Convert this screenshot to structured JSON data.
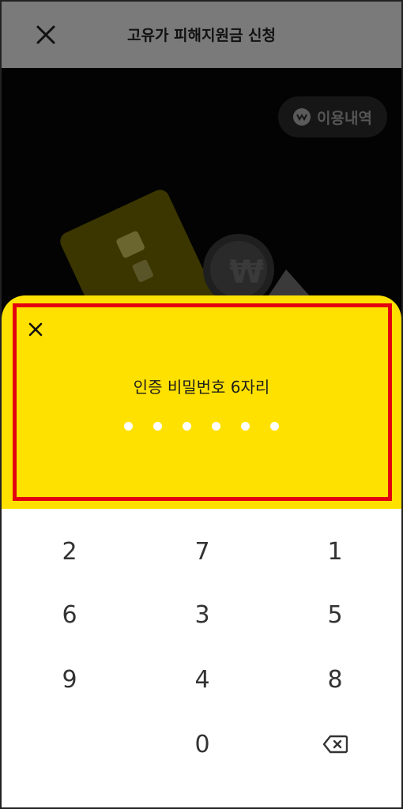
{
  "header": {
    "title": "고유가 피해지원금 신청",
    "close_icon": "close-icon"
  },
  "background": {
    "history_button": {
      "label": "이용내역",
      "icon": "w-logo-icon"
    }
  },
  "sheet": {
    "close_icon": "close-icon",
    "prompt": "인증 비밀번호 6자리",
    "pin_length": 6,
    "entered_digits": 0,
    "accent_color": "#ffe100"
  },
  "keypad": {
    "keys": [
      "2",
      "7",
      "1",
      "6",
      "3",
      "5",
      "9",
      "4",
      "8",
      "",
      "0",
      "backspace"
    ],
    "backspace_icon": "backspace-icon"
  },
  "highlight_color": "#e3000f"
}
